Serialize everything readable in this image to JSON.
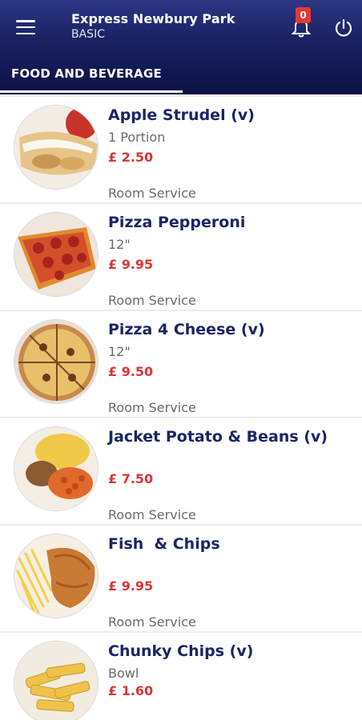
{
  "header": {
    "title": "Express Newbury Park",
    "subtitle": "BASIC",
    "notification_count": "0"
  },
  "tab": {
    "label": "FOOD AND BEVERAGE"
  },
  "items": [
    {
      "name": "Apple Strudel (v)",
      "size": "1 Portion",
      "price": "£ 2.50",
      "service": "Room Service"
    },
    {
      "name": "Pizza Pepperoni",
      "size": "12\"",
      "price": "£ 9.95",
      "service": "Room Service"
    },
    {
      "name": "Pizza 4 Cheese (v)",
      "size": "12\"",
      "price": "£ 9.50",
      "service": "Room Service"
    },
    {
      "name": "Jacket Potato & Beans (v)",
      "size": "",
      "price": "£ 7.50",
      "service": "Room Service"
    },
    {
      "name": "Fish  & Chips",
      "size": "",
      "price": "£ 9.95",
      "service": "Room Service"
    },
    {
      "name": "Chunky Chips (v)",
      "size": "Bowl",
      "price": "£ 1.60",
      "service": ""
    }
  ]
}
